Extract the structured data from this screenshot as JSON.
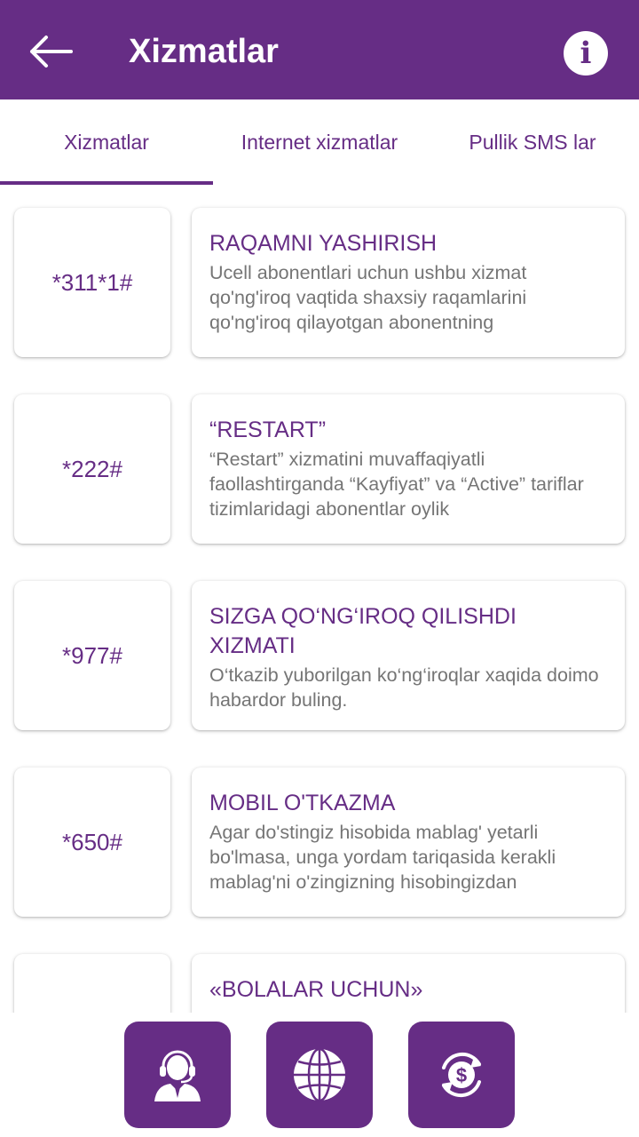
{
  "appbar": {
    "title": "Xizmatlar",
    "back_icon": "arrow-left-icon",
    "info_icon": "info-icon",
    "info_glyph": "i"
  },
  "tabs": [
    {
      "label": "Xizmatlar",
      "active": true
    },
    {
      "label": "Internet xizmatlar",
      "active": false
    },
    {
      "label": "Pullik SMS lar",
      "active": false
    }
  ],
  "services": [
    {
      "code": "*311*1#",
      "title": "RAQAMNI YASHIRISH",
      "description": "Ucell abonentlari uchun ushbu xizmat qo'ng'iroq vaqtida shaxsiy raqamlarini qo'ng'iroq qilayotgan abonentning"
    },
    {
      "code": "*222#",
      "title": "“RESTART”",
      "description": "“Restart” xizmatini muvaffaqiyatli faollashtirganda “Kayfiyat” va “Active” tariflar tizimlaridagi abonentlar oylik"
    },
    {
      "code": "*977#",
      "title": "SIZGA QO‘NG‘IROQ QILISHDI XIZMATI",
      "description": "O‘tkazib yuborilgan ko‘ng‘iroqlar xaqida doimo habardor buling."
    },
    {
      "code": "*650#",
      "title": "MOBIL O'TKAZMA",
      "description": "Agar do'stingiz hisobida mablag' yetarli bo'lmasa, unga yordam tariqasida kerakli mablag'ni o'zingizning hisobingizdan"
    },
    {
      "code": "",
      "title": "«BOLALAR UCHUN»",
      "description": ""
    }
  ],
  "bottom_nav": [
    {
      "icon": "support-agent-icon"
    },
    {
      "icon": "globe-icon"
    },
    {
      "icon": "money-exchange-icon"
    }
  ],
  "colors": {
    "primary": "#662d85",
    "background": "#ffffff",
    "body_text": "#757575"
  }
}
